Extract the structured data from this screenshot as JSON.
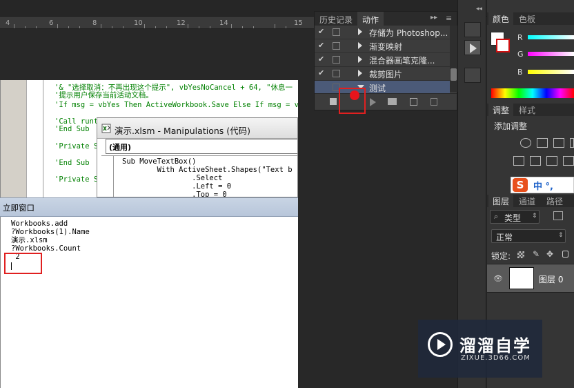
{
  "ruler": {
    "ticks": [
      "4",
      "6",
      "8",
      "10",
      "12",
      "14",
      "15"
    ]
  },
  "vba_code": {
    "lines": [
      "'& \"选择取消：不再出现这个提示\", vbYesNoCancel + 64, \"休息一",
      "'提示用户保存当前活动文档。",
      "'If msg = vbYes Then ActiveWorkbook.Save Else If msg = vbCan",
      "",
      "'Call runt",
      "'End Sub",
      "",
      "'Private Su",
      "",
      "'End Sub",
      "",
      "'Private Su"
    ]
  },
  "child_window": {
    "title": "演示.xlsm - Manipulations (代码)",
    "scope": "(通用)",
    "code": [
      "Sub MoveTextBox()",
      "        With ActiveSheet.Shapes(\"Text b",
      "                .Select",
      "                .Left = 0",
      "                .Top = 0"
    ]
  },
  "immediate": {
    "title": "立即窗口",
    "lines": [
      "Workbooks.add",
      "?Workbooks(1).Name",
      "演示.xlsm",
      "?Workbooks.Count",
      " 2"
    ]
  },
  "actions_panel": {
    "tabs": [
      "历史记录",
      "动作"
    ],
    "active_tab": "动作",
    "rows": [
      {
        "label": "存储为 Photoshop...",
        "checked": true
      },
      {
        "label": "渐变映射",
        "checked": true
      },
      {
        "label": "混合器画笔克隆...",
        "checked": true
      },
      {
        "label": "裁剪图片",
        "checked": true
      },
      {
        "label": "测试",
        "checked": false,
        "selected": true
      }
    ],
    "colors": {
      "record": "#e8141c",
      "highlight": "#e02020",
      "selected_row": "#4b5a78"
    }
  },
  "color_panel": {
    "tabs": [
      "颜色",
      "色板"
    ],
    "active_tab": "颜色",
    "channels": [
      "R",
      "G",
      "B"
    ]
  },
  "adjust_panel": {
    "tabs": [
      "调整",
      "样式"
    ],
    "active_tab": "调整",
    "title": "添加调整"
  },
  "ime": {
    "icon": "S",
    "text": "中 °,"
  },
  "layers_panel": {
    "tabs": [
      "图层",
      "通道",
      "路径"
    ],
    "active_tab": "图层",
    "filter": "类型",
    "blend_mode": "正常",
    "lock_label": "锁定:",
    "layer_name": "图层 0"
  },
  "watermark": {
    "title": "溜溜自学",
    "url": "ZIXUE.3D66.COM"
  }
}
